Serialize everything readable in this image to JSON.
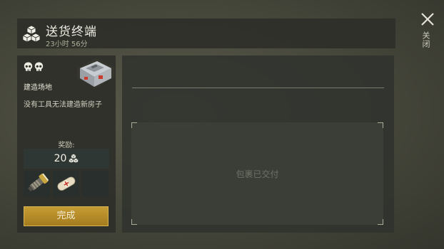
{
  "header": {
    "title": "送货终端",
    "timer": "23小时 56分",
    "icon": "supply-cubes-icon"
  },
  "close": {
    "label": "关闭",
    "icon": "close-x-icon"
  },
  "location": {
    "difficulty_icon": "skull-icon",
    "difficulty_count": 2,
    "name": "建造场地",
    "description": "没有工具无法建造新房子",
    "image": "toolbox-icon"
  },
  "reward": {
    "label": "奖励:",
    "amount": "20",
    "currency_icon": "cubes-currency-icon"
  },
  "items": [
    {
      "name": "flashlight-icon"
    },
    {
      "name": "bandage-icon"
    },
    {
      "name": "empty-slot"
    }
  ],
  "complete_button": {
    "label": "完成",
    "color": "#b38a27"
  },
  "delivery": {
    "status": "包裹已交付"
  }
}
